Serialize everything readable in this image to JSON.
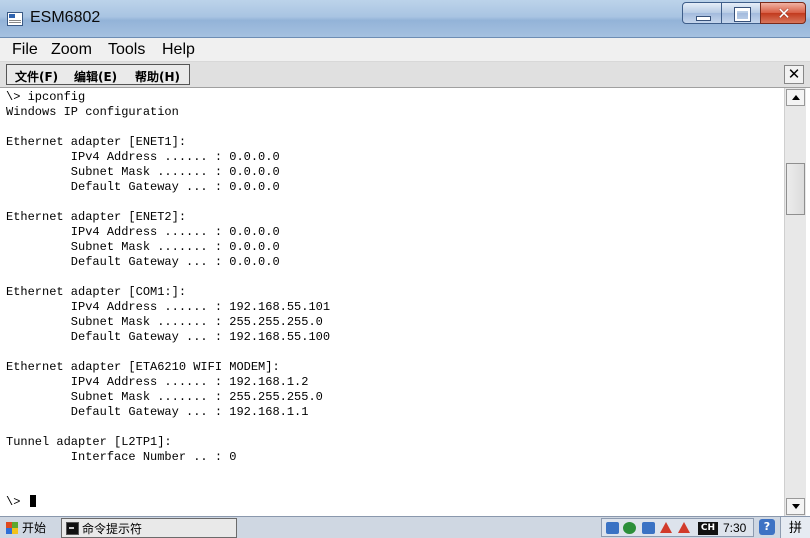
{
  "window": {
    "title": "ESM6802",
    "minimize_glyph": "",
    "maximize_glyph": "",
    "close_glyph": "✕"
  },
  "menubar": [
    {
      "label": "File"
    },
    {
      "label": "Zoom"
    },
    {
      "label": "Tools"
    },
    {
      "label": "Help"
    }
  ],
  "inner_menu": {
    "items": [
      {
        "label": "文件(F)"
      },
      {
        "label": "编辑(E)"
      },
      {
        "label": "帮助(H)"
      }
    ],
    "close_glyph": "✕"
  },
  "console": {
    "lines": [
      "\\> ipconfig",
      "Windows IP configuration",
      "",
      "Ethernet adapter [ENET1]:",
      "         IPv4 Address ...... : 0.0.0.0",
      "         Subnet Mask ....... : 0.0.0.0",
      "         Default Gateway ... : 0.0.0.0",
      "",
      "Ethernet adapter [ENET2]:",
      "         IPv4 Address ...... : 0.0.0.0",
      "         Subnet Mask ....... : 0.0.0.0",
      "         Default Gateway ... : 0.0.0.0",
      "",
      "Ethernet adapter [COM1:]:",
      "         IPv4 Address ...... : 192.168.55.101",
      "         Subnet Mask ....... : 255.255.255.0",
      "         Default Gateway ... : 192.168.55.100",
      "",
      "Ethernet adapter [ETA6210 WIFI MODEM]:",
      "         IPv4 Address ...... : 192.168.1.2",
      "         Subnet Mask ....... : 255.255.255.0",
      "         Default Gateway ... : 192.168.1.1",
      "",
      "Tunnel adapter [L2TP1]:",
      "         Interface Number .. : 0",
      "",
      "",
      "\\> "
    ]
  },
  "taskbar": {
    "start_label": "开始",
    "task_label": "命令提示符",
    "tray_lang": "CH",
    "clock": "7:30",
    "help_glyph": "?",
    "ime_label": "拼"
  },
  "colors": {
    "console_bg": "#ffffff",
    "console_fg": "#000000",
    "close_button": "#c8442a"
  },
  "icons": {
    "app": "app-window-icon",
    "tray": [
      "network-icon",
      "antivirus-icon",
      "network-icon",
      "alert-icon",
      "alert-icon"
    ]
  }
}
